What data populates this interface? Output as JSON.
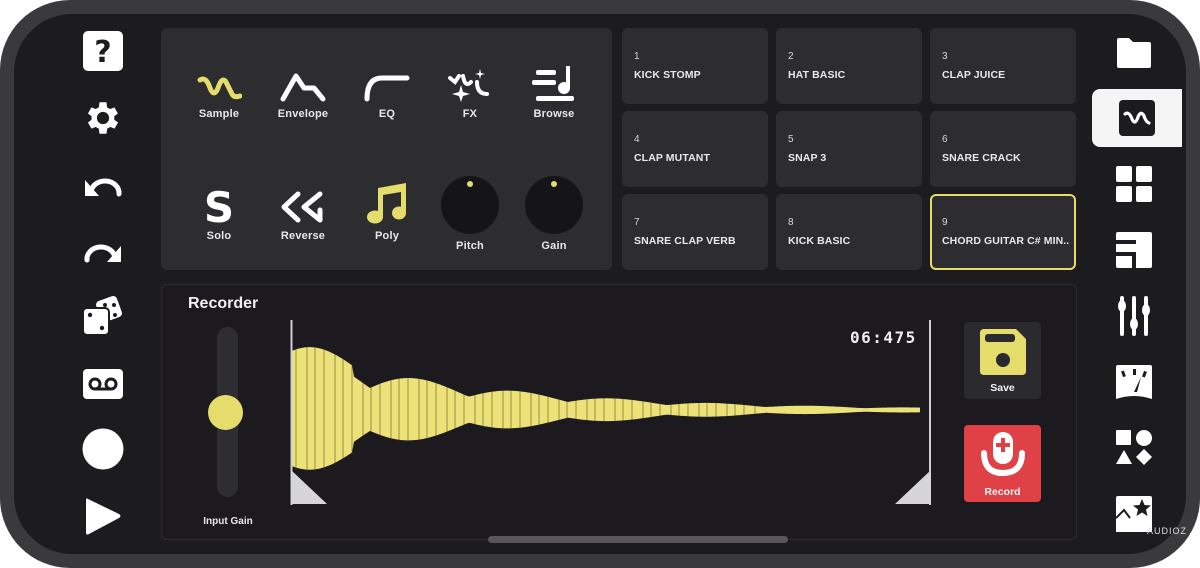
{
  "left_toolbar": {
    "items": [
      {
        "icon": "help-icon",
        "label": "Help"
      },
      {
        "icon": "gear-icon",
        "label": "Settings"
      },
      {
        "icon": "undo-icon",
        "label": "Undo"
      },
      {
        "icon": "redo-icon",
        "label": "Redo"
      },
      {
        "icon": "dice-icon",
        "label": "Randomize"
      },
      {
        "icon": "voicemail-icon",
        "label": "Recorder"
      },
      {
        "icon": "record-circle-icon",
        "label": "Record"
      },
      {
        "icon": "play-icon",
        "label": "Play"
      }
    ]
  },
  "controls": {
    "row1": [
      {
        "label": "Sample",
        "icon": "sample-wave-icon",
        "active": true
      },
      {
        "label": "Envelope",
        "icon": "envelope-icon",
        "active": false
      },
      {
        "label": "EQ",
        "icon": "eq-curve-icon",
        "active": false
      },
      {
        "label": "FX",
        "icon": "fx-sparkle-icon",
        "active": false
      },
      {
        "label": "Browse",
        "icon": "browse-icon",
        "active": false
      }
    ],
    "row2": [
      {
        "label": "Solo",
        "icon": "solo-s-icon",
        "active": false
      },
      {
        "label": "Reverse",
        "icon": "reverse-icon",
        "active": false
      },
      {
        "label": "Poly",
        "icon": "music-note-icon",
        "active": true
      }
    ],
    "knobs": [
      {
        "label": "Pitch",
        "value": 0.5
      },
      {
        "label": "Gain",
        "value": 0.5
      }
    ]
  },
  "pads": [
    {
      "number": "1",
      "name": "KICK STOMP",
      "selected": false
    },
    {
      "number": "2",
      "name": "HAT BASIC",
      "selected": false
    },
    {
      "number": "3",
      "name": "CLAP JUICE",
      "selected": false
    },
    {
      "number": "4",
      "name": "CLAP MUTANT",
      "selected": false
    },
    {
      "number": "5",
      "name": "SNAP 3",
      "selected": false
    },
    {
      "number": "6",
      "name": "SNARE CRACK",
      "selected": false
    },
    {
      "number": "7",
      "name": "SNARE CLAP VERB",
      "selected": false
    },
    {
      "number": "8",
      "name": "KICK BASIC",
      "selected": false
    },
    {
      "number": "9",
      "name": "CHORD GUITAR C# MIN..",
      "selected": true
    }
  ],
  "recorder": {
    "title": "Recorder",
    "input_gain_label": "Input Gain",
    "input_gain_value": 0.5,
    "time": "06:475",
    "save_label": "Save",
    "record_label": "Record"
  },
  "right_toolbar": {
    "items": [
      {
        "icon": "folder-icon",
        "label": "Files",
        "active": false
      },
      {
        "icon": "sample-editor-icon",
        "label": "Sample Editor",
        "active": true
      },
      {
        "icon": "pads-grid-icon",
        "label": "Pads",
        "active": false
      },
      {
        "icon": "keyboard-icon",
        "label": "Keys",
        "active": false
      },
      {
        "icon": "mixer-icon",
        "label": "Mixer",
        "active": false
      },
      {
        "icon": "meter-icon",
        "label": "Meter",
        "active": false
      },
      {
        "icon": "shapes-icon",
        "label": "Shapes",
        "active": false
      },
      {
        "icon": "image-star-icon",
        "label": "Gallery",
        "active": false
      }
    ]
  },
  "watermark": "AUDIOZ",
  "colors": {
    "accent": "#e5dd6b",
    "record": "#e04146",
    "panel": "#2d2c2f",
    "background": "#1c1b1e"
  }
}
